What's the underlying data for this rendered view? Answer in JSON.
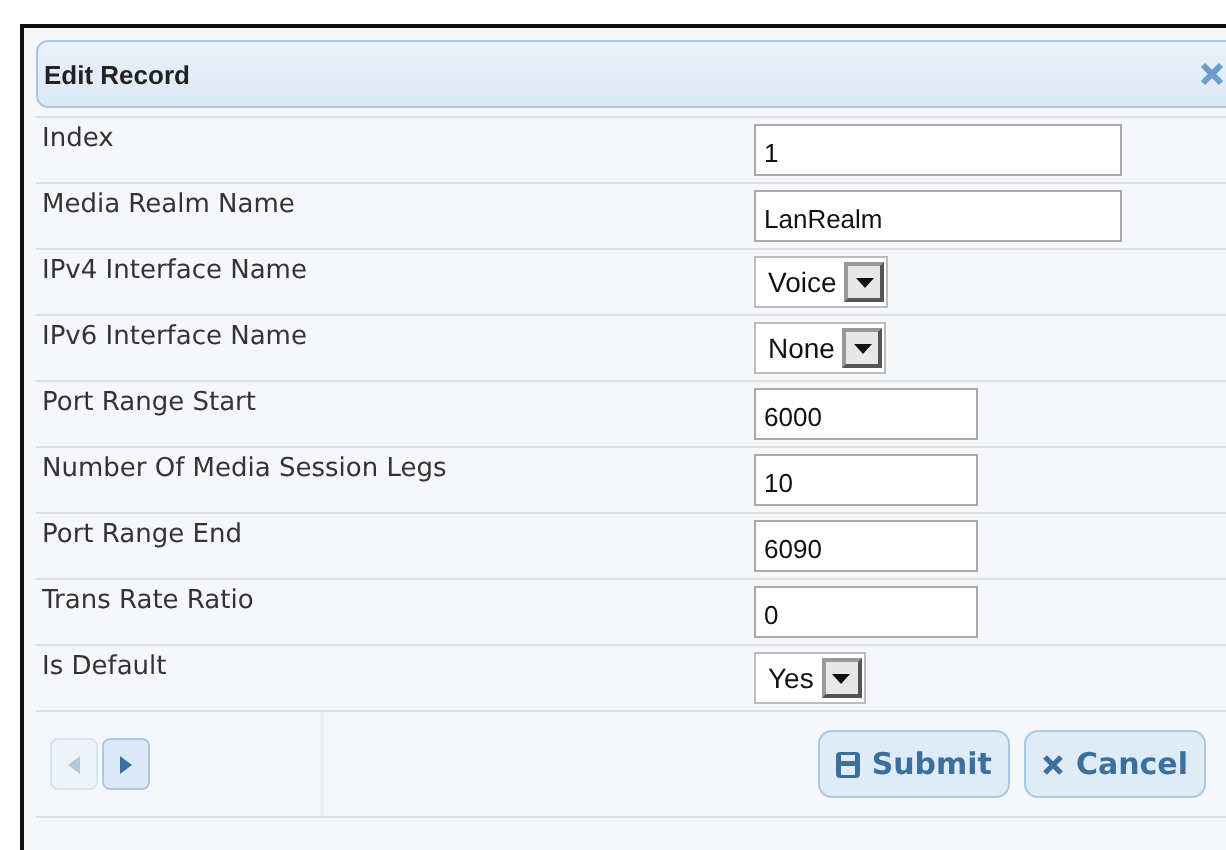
{
  "dialog": {
    "title": "Edit Record"
  },
  "fields": [
    {
      "label": "Index",
      "kind": "text",
      "value": "1",
      "wide": true
    },
    {
      "label": "Media Realm Name",
      "kind": "text",
      "value": "LanRealm",
      "wide": true
    },
    {
      "label": "IPv4 Interface Name",
      "kind": "select",
      "value": "Voice"
    },
    {
      "label": "IPv6 Interface Name",
      "kind": "select",
      "value": "None"
    },
    {
      "label": "Port Range Start",
      "kind": "text",
      "value": "6000",
      "wide": false
    },
    {
      "label": "Number Of Media Session Legs",
      "kind": "text",
      "value": "10",
      "wide": false
    },
    {
      "label": "Port Range End",
      "kind": "text",
      "value": "6090",
      "wide": false
    },
    {
      "label": "Trans Rate Ratio",
      "kind": "text",
      "value": "0",
      "wide": false
    },
    {
      "label": "Is Default",
      "kind": "select",
      "value": "Yes"
    }
  ],
  "pager": [
    {
      "kind": "previous",
      "disabled": true
    },
    {
      "kind": "next",
      "disabled": false
    }
  ],
  "buttons": [
    {
      "label": "Submit",
      "kind": "submit"
    },
    {
      "label": "Cancel",
      "kind": "cancel"
    }
  ]
}
